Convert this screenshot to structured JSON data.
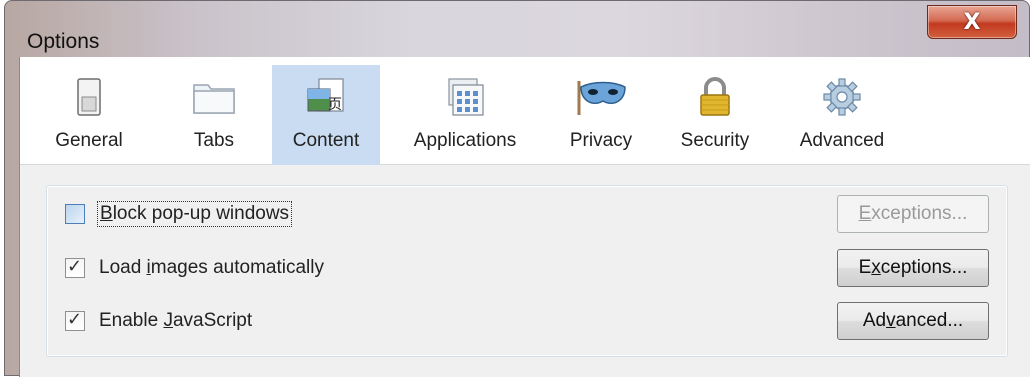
{
  "window": {
    "title": "Options",
    "close_glyph": "X"
  },
  "tabs": [
    {
      "label": "General",
      "icon": "switch-icon"
    },
    {
      "label": "Tabs",
      "icon": "folder-tab-icon"
    },
    {
      "label": "Content",
      "icon": "content-page-icon",
      "selected": true
    },
    {
      "label": "Applications",
      "icon": "applications-window-icon"
    },
    {
      "label": "Privacy",
      "icon": "mask-icon"
    },
    {
      "label": "Security",
      "icon": "padlock-icon"
    },
    {
      "label": "Advanced",
      "icon": "gear-icon"
    }
  ],
  "content": {
    "block_popups": {
      "pre": "",
      "accel": "B",
      "post": "lock pop-up windows",
      "checked": false
    },
    "load_images": {
      "pre": "Load ",
      "accel": "i",
      "post": "mages automatically",
      "checked": true
    },
    "enable_js": {
      "pre": "Enable ",
      "accel": "J",
      "post": "avaScript",
      "checked": true
    },
    "exceptions_popup": {
      "pre": "",
      "accel": "E",
      "post": "xceptions...",
      "disabled": true
    },
    "exceptions_images": {
      "pre": "E",
      "accel": "x",
      "post": "ceptions...",
      "disabled": false
    },
    "advanced_js": {
      "pre": "Ad",
      "accel": "v",
      "post": "anced...",
      "disabled": false
    }
  },
  "colors": {
    "selected_tab": "#c9dcf2",
    "close_button": "#c23a1f"
  }
}
